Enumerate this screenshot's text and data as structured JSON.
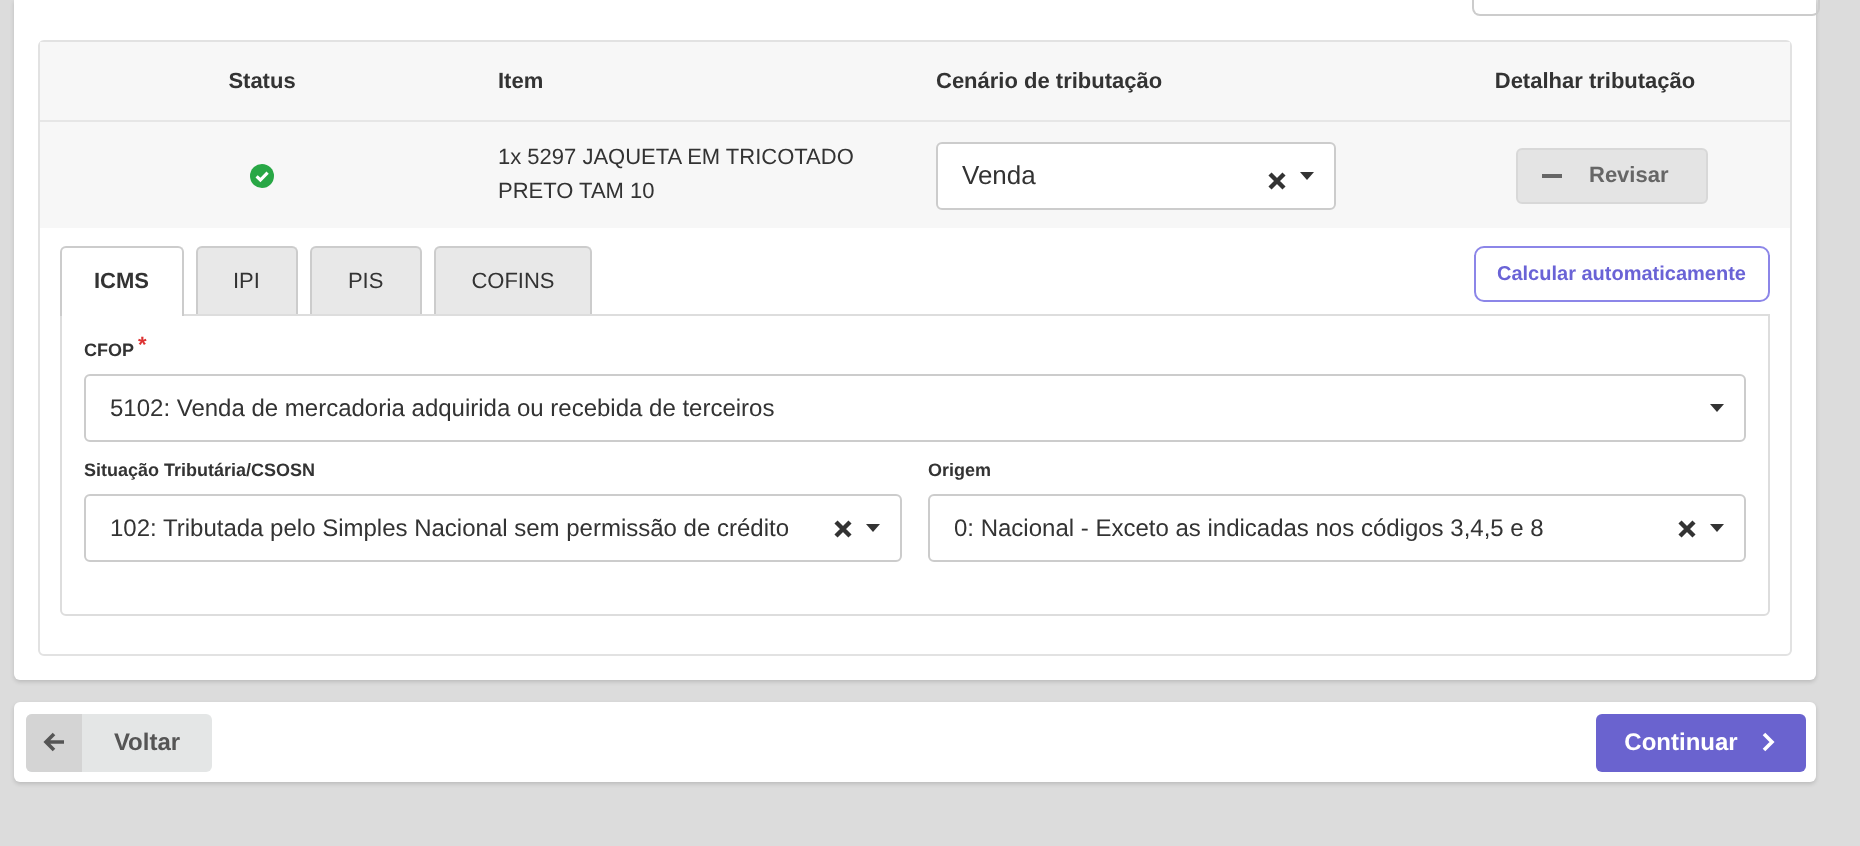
{
  "table": {
    "columns": [
      "Status",
      "Item",
      "Cenário de tributação",
      "Detalhar tributação"
    ],
    "rows": [
      {
        "done": true,
        "item": "1x 5297 JAQUETA EM TRICOTADO PRETO TAM 10",
        "scenario": "Venda",
        "clearable": true,
        "action": "Revisar"
      }
    ]
  },
  "tabs": [
    {
      "label": "ICMS",
      "selected": true
    },
    {
      "label": "IPI",
      "selected": false
    },
    {
      "label": "PIS",
      "selected": false
    },
    {
      "label": "COFINS",
      "selected": false
    }
  ],
  "auto_button": "Calcular automaticamente",
  "cfop": {
    "label": "CFOP",
    "required_mark": "*",
    "value": "5102: Venda de mercadoria adquirida ou recebida de terceiros",
    "clearable": false
  },
  "situacao": {
    "label": "Situação Tributária/CSOSN",
    "value": "102: Tributada pelo Simples Nacional sem permissão de crédito",
    "clearable": true
  },
  "origem": {
    "label": "Origem",
    "value": "0: Nacional - Exceto as indicadas nos códigos 3,4,5 e 8",
    "clearable": true
  },
  "back_button": "Voltar",
  "next_button": "Continuar"
}
